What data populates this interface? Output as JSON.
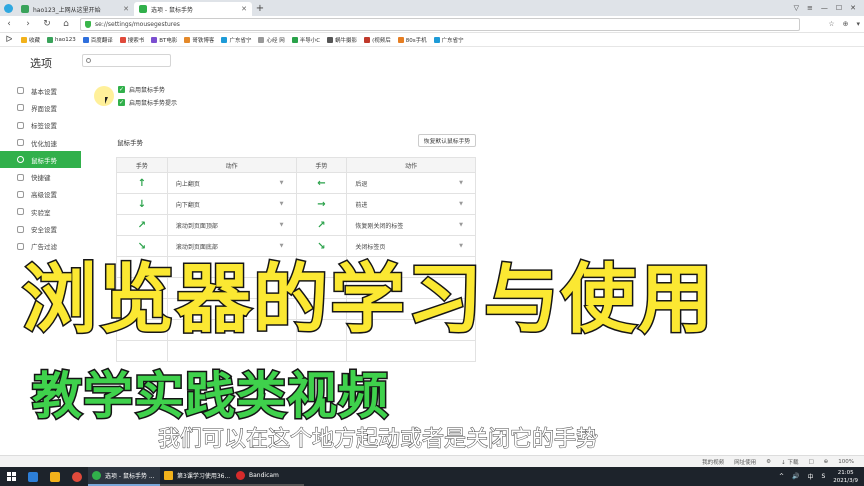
{
  "browser": {
    "tabs": [
      {
        "label": "hao123_上网从这里开始",
        "favicon_color": "#3aa35b",
        "active": false
      },
      {
        "label": "选项 - 鼠标手势",
        "favicon_color": "#31b04b",
        "active": true
      }
    ],
    "window_controls": [
      "▽",
      "≡",
      "—",
      "☐",
      "✕"
    ],
    "address": {
      "url": "se://settings/mousegestures"
    },
    "nav_buttons": [
      "‹",
      "›",
      "↻",
      "⌂"
    ],
    "addr_right_icons": [
      "☆",
      "⊕",
      "▾"
    ],
    "bookmarks": [
      {
        "label": "收藏",
        "color": "#f2b21b"
      },
      {
        "label": "hao123",
        "color": "#3aa35b"
      },
      {
        "label": "百度翻译",
        "color": "#2f6fdc"
      },
      {
        "label": "搜索书",
        "color": "#e04a3b"
      },
      {
        "label": "BT电影",
        "color": "#7b4fd0"
      },
      {
        "label": "哥铁博客",
        "color": "#e4892a"
      },
      {
        "label": "广东省宁",
        "color": "#1e9bd7"
      },
      {
        "label": "心经 网",
        "color": "#999999"
      },
      {
        "label": "半导小C",
        "color": "#2aa24a"
      },
      {
        "label": "蜗牛摄影",
        "color": "#555555"
      },
      {
        "label": "(视频后",
        "color": "#c0392b"
      },
      {
        "label": "80s手机",
        "color": "#e67e22"
      },
      {
        "label": "广东省宁",
        "color": "#1e9bd7"
      }
    ]
  },
  "settings": {
    "title": "选项",
    "search": {
      "value": "",
      "placeholder": ""
    },
    "nav": [
      {
        "label": "基本设置",
        "active": false
      },
      {
        "label": "界面设置",
        "active": false
      },
      {
        "label": "标签设置",
        "active": false
      },
      {
        "label": "优化加速",
        "active": false
      },
      {
        "label": "鼠标手势",
        "active": true
      },
      {
        "label": "快捷键",
        "active": false
      },
      {
        "label": "高级设置",
        "active": false
      },
      {
        "label": "实验室",
        "active": false
      },
      {
        "label": "安全设置",
        "active": false
      },
      {
        "label": "广告过滤",
        "active": false
      }
    ],
    "checkboxes": [
      {
        "label": "启用鼠标手势",
        "checked": true
      },
      {
        "label": "启用鼠标手势提示",
        "checked": true
      }
    ],
    "section_title": "鼠标手势",
    "reset_button": "恢复默认鼠标手势",
    "table_headers": [
      "手势",
      "动作",
      "手势",
      "动作"
    ],
    "rows": [
      {
        "g1": "↑",
        "a1": "向上翻页",
        "g2": "←",
        "a2": "后退"
      },
      {
        "g1": "↓",
        "a1": "向下翻页",
        "g2": "→",
        "a2": "前进"
      },
      {
        "g1": "↗",
        "a1": "滚动到页面顶部",
        "g2": "↗",
        "a2": "恢复刚关闭的标签"
      },
      {
        "g1": "↘",
        "a1": "滚动到页面底部",
        "g2": "↘",
        "a2": "关闭标签页"
      },
      {
        "g1": "",
        "a1": "",
        "g2": "",
        "a2": ""
      },
      {
        "g1": "",
        "a1": "",
        "g2": "",
        "a2": ""
      },
      {
        "g1": "",
        "a1": "",
        "g2": "",
        "a2": ""
      },
      {
        "g1": "",
        "a1": "",
        "g2": "",
        "a2": ""
      },
      {
        "g1": "",
        "a1": "",
        "g2": "",
        "a2": ""
      }
    ]
  },
  "overlay": {
    "title": "浏览器的学习与使用",
    "subtitle": "教学实践类视频",
    "caption": "我们可以在这个地方起动或者是关闭它的手势"
  },
  "statusbar": {
    "items": [
      "我的视频",
      "网址使用",
      "⚙",
      "↓ 下载",
      "□",
      "⊕",
      "100%"
    ]
  },
  "taskbar": {
    "apps": [
      {
        "label": "选项 - 鼠标手势 ...",
        "color": "#31b04b"
      },
      {
        "label": "第3课学习使用36...",
        "color": "#f2b21b"
      },
      {
        "label": "Bandicam",
        "color": "#d62b2b"
      }
    ],
    "pinned_colors": [
      "#2d7fd8",
      "#f2b21b",
      "#e04a3b"
    ],
    "tray_items": [
      "^",
      "🔊",
      "中",
      "S"
    ],
    "time": "21:05",
    "date": "2021/3/9"
  }
}
